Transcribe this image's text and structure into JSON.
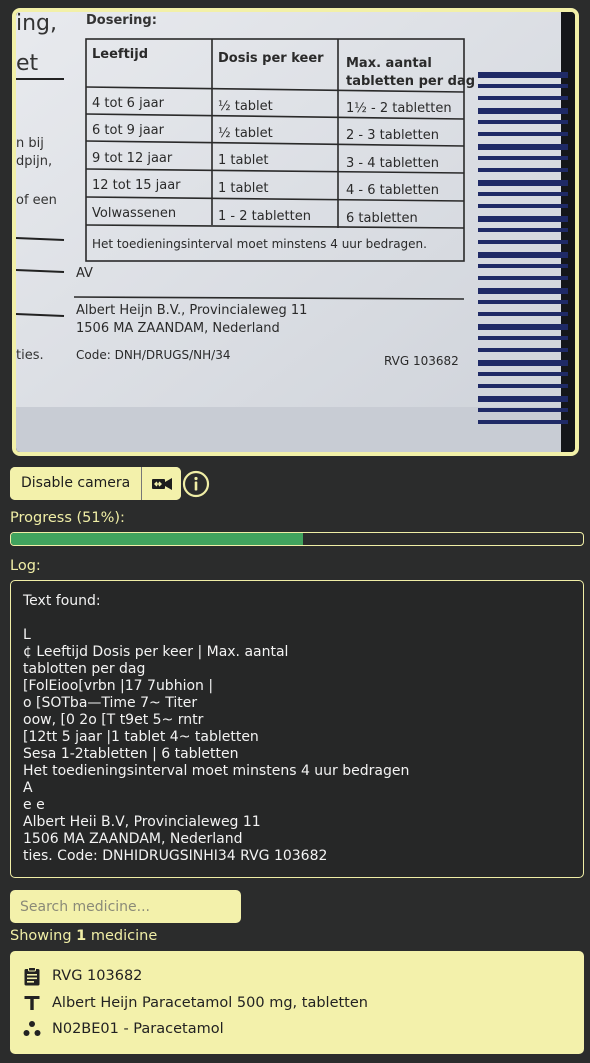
{
  "camera_label": {
    "heading": "Dosering:",
    "headers": [
      "Leeftijd",
      "Dosis per keer",
      "Max. aantal",
      "tabletten per dag"
    ],
    "rows": [
      [
        "4 tot 6 jaar",
        "½ tablet",
        "1½ - 2 tabletten"
      ],
      [
        "6 tot 9 jaar",
        "½ tablet",
        "2 - 3 tabletten"
      ],
      [
        "9 tot 12 jaar",
        "1 tablet",
        "3 - 4 tabletten"
      ],
      [
        "12 tot 15 jaar",
        "1 tablet",
        "4 - 6 tabletten"
      ],
      [
        "Volwassenen",
        "1 - 2 tabletten",
        "6 tabletten"
      ]
    ],
    "interval_note": "Het toedieningsinterval moet minstens 4 uur bedragen.",
    "av": "AV",
    "company": "Albert Heijn B.V., Provincialeweg 11",
    "city": "1506 MA ZAANDAM, Nederland",
    "code": "Code: DNH/DRUGS/NH/34",
    "rvg": "RVG 103682",
    "left_fragments": [
      "ing,",
      "et",
      "n bij",
      "dpijn,",
      "of een",
      "ties."
    ]
  },
  "controls": {
    "disable_camera": "Disable camera",
    "camera_icon": "camera-switch-icon",
    "info_icon": "info-icon"
  },
  "progress": {
    "label": "Progress (51%):",
    "value": 0.51,
    "color": "#41a35e"
  },
  "log": {
    "label": "Log:",
    "text": "Text found:\n\nL\n¢ Leeftijd Dosis per keer | Max. aantal\ntablotten per dag\n[FolEioo[vrbn |17 7ubhion |\no [SOTba—Time 7~ Titer\noow, [0 2o [T t9et 5~ rntr\n[12tt 5 jaar |1 tablet 4~ tabletten\nSesa 1-2tabletten | 6 tabletten\nHet toedieningsinterval moet minstens 4 uur bedragen\nA\ne e\nAlbert Heii B.V, Provincialeweg 11\n1506 MA ZAANDAM, Nederland\nties. Code: DNHIDRUGSINHI34 RVG 103682"
  },
  "search": {
    "placeholder": "Search medicine..."
  },
  "results": {
    "prefix": "Showing",
    "count": "1",
    "suffix": "medicine",
    "items": [
      {
        "registration": "RVG 103682",
        "name": "Albert Heijn Paracetamol 500 mg, tabletten",
        "atc": "N02BE01 - Paracetamol"
      }
    ]
  },
  "colors": {
    "background": "#2b2c2c",
    "accent": "#f3f1ab",
    "text": "#f0eea6",
    "progress": "#41a35e"
  }
}
